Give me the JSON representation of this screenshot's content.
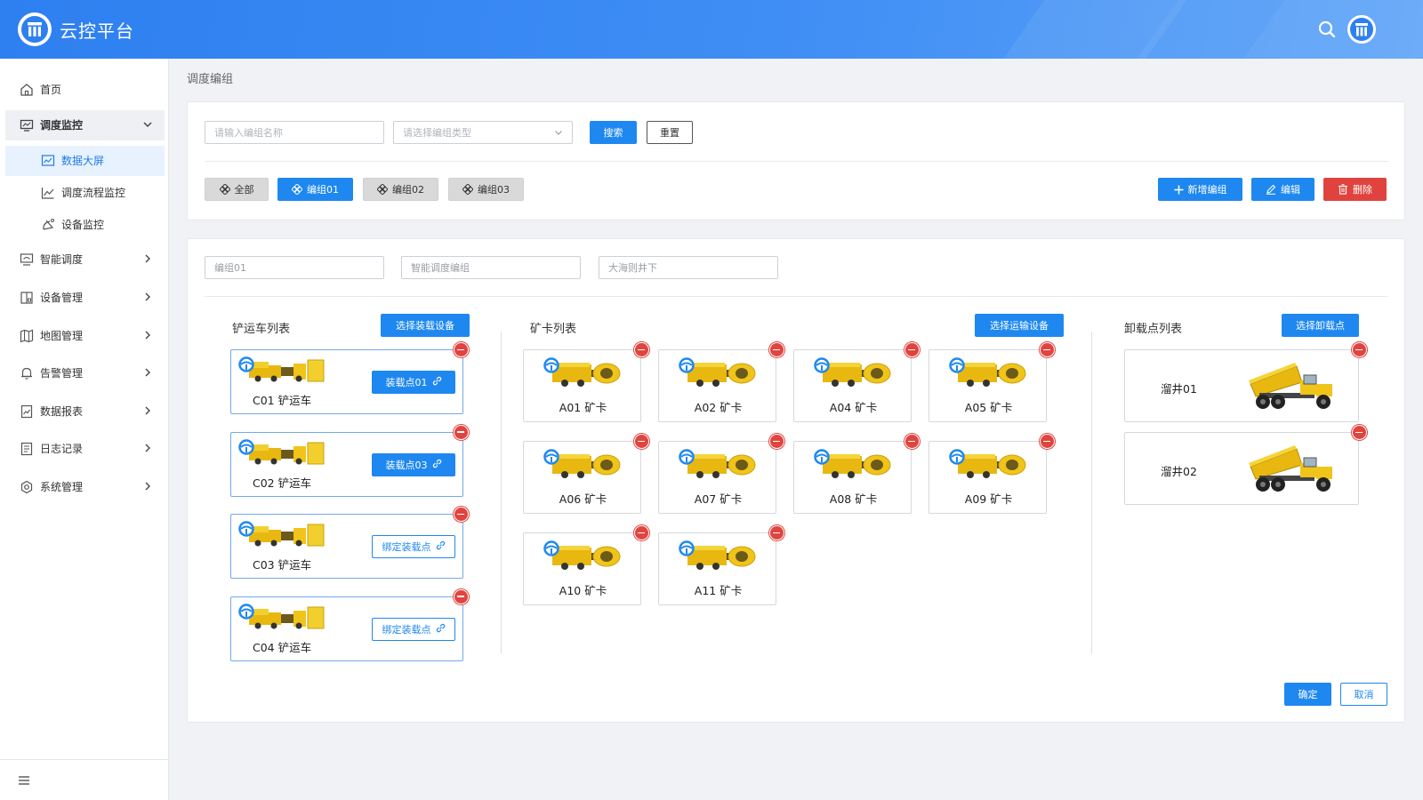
{
  "header": {
    "title": "云控平台",
    "search_icon": "search-icon",
    "avatar_icon": "user-avatar"
  },
  "sidebar": {
    "items": [
      {
        "label": "首页",
        "icon": "home-icon"
      },
      {
        "label": "调度监控",
        "icon": "monitor-icon",
        "expanded": true,
        "children": [
          {
            "label": "数据大屏",
            "icon": "screen-chart-icon",
            "active": true
          },
          {
            "label": "调度流程监控",
            "icon": "trend-icon"
          },
          {
            "label": "设备监控",
            "icon": "satellite-icon"
          }
        ]
      },
      {
        "label": "智能调度",
        "icon": "smart-screen-icon"
      },
      {
        "label": "设备管理",
        "icon": "device-icon"
      },
      {
        "label": "地图管理",
        "icon": "map-icon"
      },
      {
        "label": "告警管理",
        "icon": "bell-icon"
      },
      {
        "label": "数据报表",
        "icon": "report-icon"
      },
      {
        "label": "日志记录",
        "icon": "log-icon"
      },
      {
        "label": "系统管理",
        "icon": "settings-icon"
      }
    ],
    "collapse_icon": "menu-icon"
  },
  "breadcrumb": "调度编组",
  "filter": {
    "name_placeholder": "请输入编组名称",
    "type_placeholder": "请选择编组类型",
    "search_label": "搜索",
    "reset_label": "重置"
  },
  "groups": {
    "tabs": [
      {
        "label": "全部",
        "active": false
      },
      {
        "label": "编组01",
        "active": true
      },
      {
        "label": "编组02",
        "active": false
      },
      {
        "label": "编组03",
        "active": false
      }
    ],
    "add_label": "新增编组",
    "edit_label": "编辑",
    "delete_label": "删除"
  },
  "detail": {
    "group_name": "编组01",
    "group_type": "智能调度编组",
    "location": "大海则井下",
    "loaders": {
      "title": "铲运车列表",
      "select_label": "选择装载设备",
      "items": [
        {
          "name": "C01 铲运车",
          "point": "装载点01",
          "bound": true
        },
        {
          "name": "C02 铲运车",
          "point": "装载点03",
          "bound": true
        },
        {
          "name": "C03 铲运车",
          "point": "绑定装载点",
          "bound": false
        },
        {
          "name": "C04 铲运车",
          "point": "绑定装载点",
          "bound": false
        }
      ]
    },
    "trucks": {
      "title": "矿卡列表",
      "select_label": "选择运输设备",
      "items": [
        "A01 矿卡",
        "A02 矿卡",
        "A04 矿卡",
        "A05 矿卡",
        "A06 矿卡",
        "A07 矿卡",
        "A08 矿卡",
        "A09 矿卡",
        "A10 矿卡",
        "A11 矿卡"
      ]
    },
    "dumps": {
      "title": "卸载点列表",
      "select_label": "选择卸载点",
      "items": [
        "溜井01",
        "溜井02"
      ]
    },
    "confirm_label": "确定",
    "cancel_label": "取消"
  },
  "colors": {
    "primary": "#1e88f0",
    "danger": "#e0433e",
    "header": "#3a8bf3",
    "vehicle_yellow": "#f0c419"
  }
}
